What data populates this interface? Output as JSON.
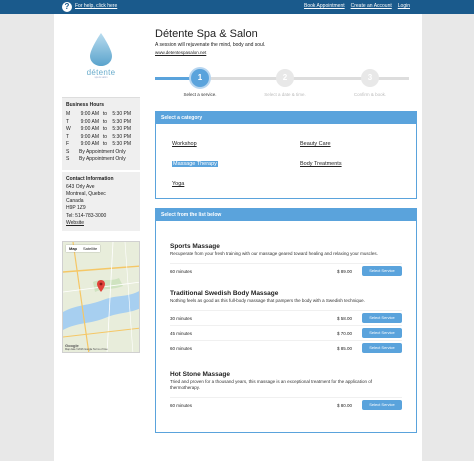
{
  "topbar": {
    "left_link": "For help, click here",
    "links": [
      "Book Appointment",
      "Create an Account",
      "Login"
    ]
  },
  "logo": {
    "name": "détente",
    "tagline": "spa & salon"
  },
  "hours": {
    "heading": "Business Hours",
    "rows": [
      {
        "day": "M",
        "open": "9:00 AM",
        "to": "to",
        "close": "5:30 PM"
      },
      {
        "day": "T",
        "open": "9:00 AM",
        "to": "to",
        "close": "5:30 PM"
      },
      {
        "day": "W",
        "open": "9:00 AM",
        "to": "to",
        "close": "5:30 PM"
      },
      {
        "day": "T",
        "open": "9:00 AM",
        "to": "to",
        "close": "5:30 PM"
      },
      {
        "day": "F",
        "open": "9:00 AM",
        "to": "to",
        "close": "5:30 PM"
      },
      {
        "day": "S",
        "note": "By Appointment Only"
      },
      {
        "day": "S",
        "note": "By Appointment Only"
      }
    ]
  },
  "contact": {
    "heading": "Contact Information",
    "address1": "643 Orly Ave",
    "address2": "Montreal, Quebec",
    "country": "Canada",
    "postal": "H9P 1Z9",
    "phone": "Tel: 514-783-3000",
    "website": "Website"
  },
  "map": {
    "tab_map": "Map",
    "tab_satellite": "Satellite",
    "google": "Google",
    "footer": "Map data ©2016 Google  Terms of Use"
  },
  "business": {
    "title": "Détente Spa & Salon",
    "tagline": "A session will rejuvenate the mind, body and soul.",
    "url": "www.detentespasalon.net"
  },
  "steps": [
    {
      "num": "1",
      "label": "Select a service."
    },
    {
      "num": "2",
      "label": "Select a date & time."
    },
    {
      "num": "3",
      "label": "Confirm & book."
    }
  ],
  "category_panel": {
    "heading": "Select a category",
    "categories": [
      "Workshop",
      "Beauty Care",
      "Massage Therapy",
      "Body Treatments",
      "Yoga"
    ],
    "selected": "Massage Therapy"
  },
  "service_panel": {
    "heading": "Select from the list below",
    "services": [
      {
        "name": "Sports Massage",
        "desc": "Recuperate from your fresh training with our massage geared toward healing and relaxing your muscles.",
        "options": [
          {
            "duration": "60 minutes",
            "price": "$ 89.00",
            "button": "Select Service"
          }
        ]
      },
      {
        "name": "Traditional Swedish Body Massage",
        "desc": "Nothing feels as good as this full-body massage that pampers the body with a Swedish technique.",
        "options": [
          {
            "duration": "30 minutes",
            "price": "$ 58.00",
            "button": "Select Service"
          },
          {
            "duration": "45 minutes",
            "price": "$ 70.00",
            "button": "Select Service"
          },
          {
            "duration": "60 minutes",
            "price": "$ 85.00",
            "button": "Select Service"
          }
        ]
      },
      {
        "name": "Hot Stone Massage",
        "desc": "Tried and proven for a thousand years, this massage is an exceptional treatment for the application of thermotherapy.",
        "options": [
          {
            "duration": "60 minutes",
            "price": "$ 80.00",
            "button": "Select Service"
          }
        ]
      }
    ]
  },
  "colors": {
    "accent": "#5aa3dc",
    "topbar": "#1a5a8c"
  }
}
